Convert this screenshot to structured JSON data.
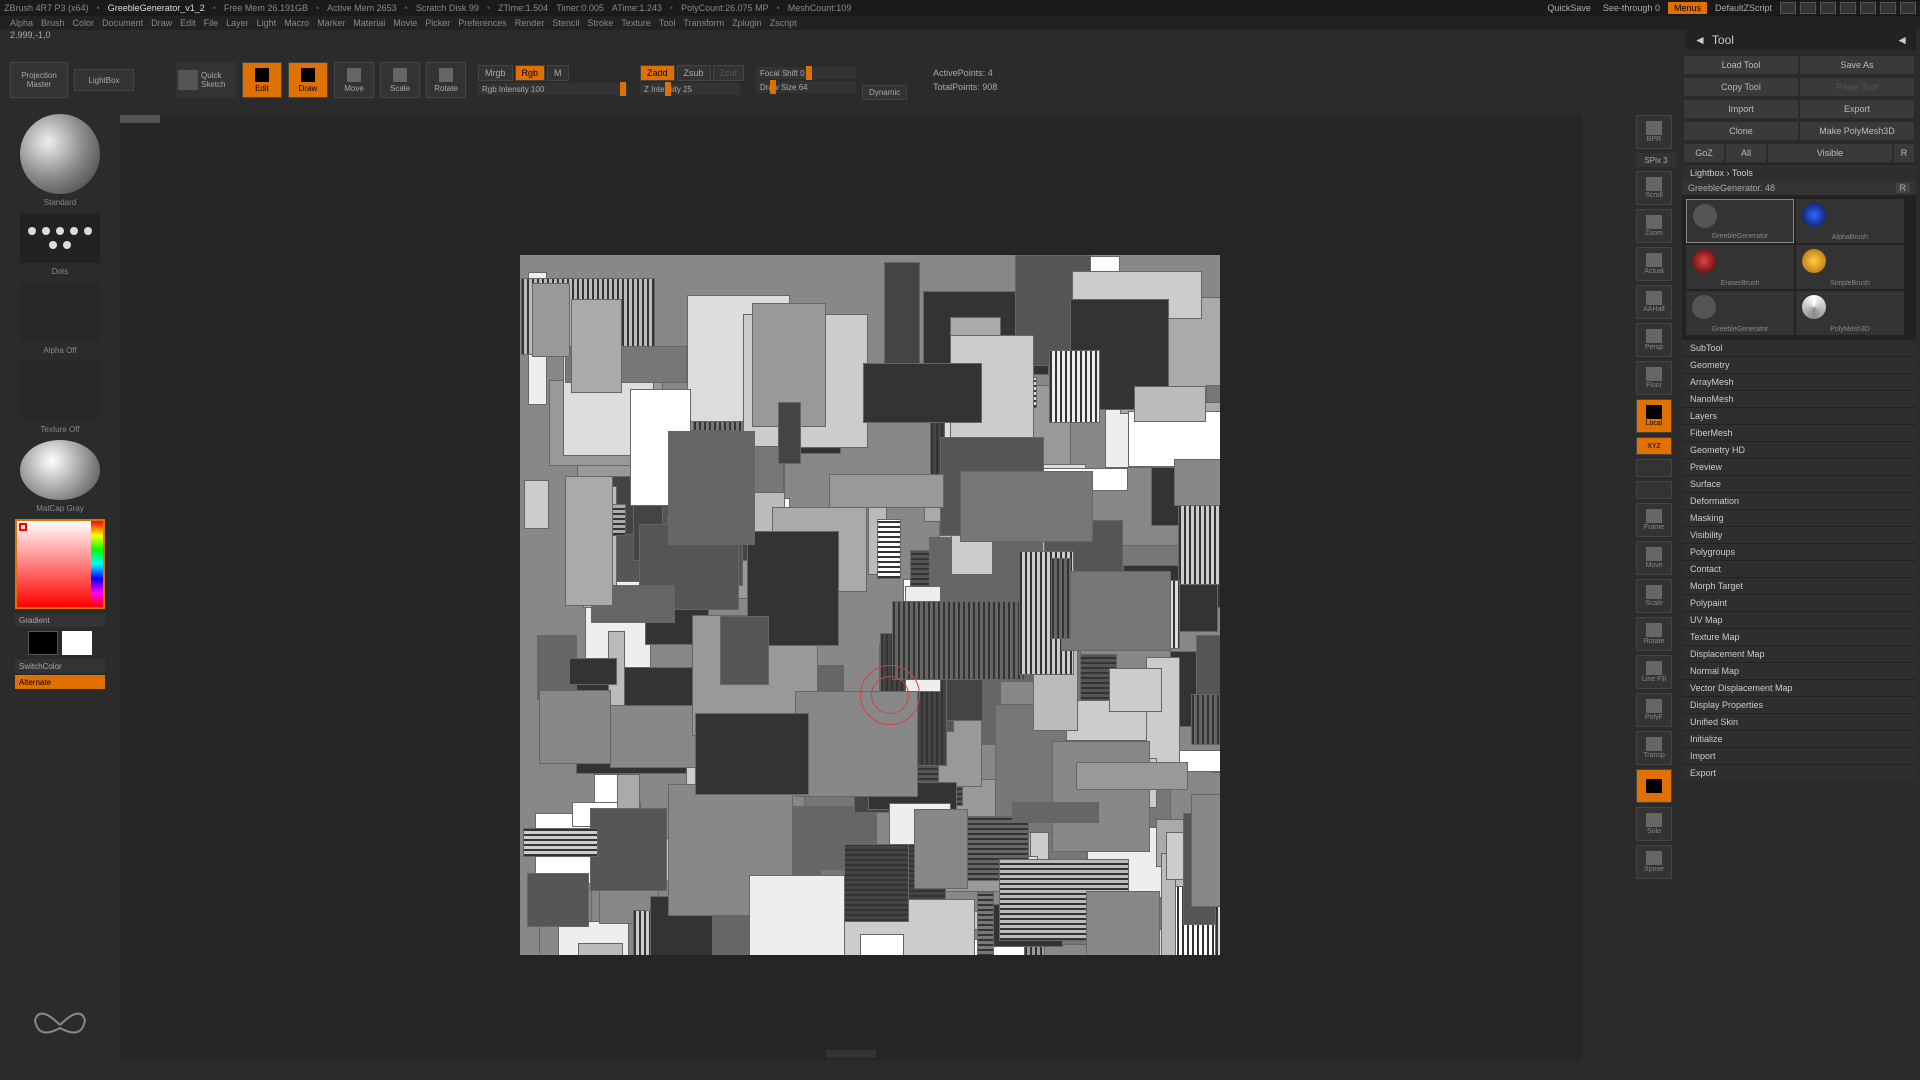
{
  "title": {
    "app": "ZBrush 4R7 P3 (x64)",
    "file": "GreebleGenerator_v1_2",
    "freemem": "Free Mem 26.191GB",
    "activemem": "Active Mem 2653",
    "scratch": "Scratch Disk 99",
    "ztime": "ZTime:1.504",
    "timer": "Timer:0.005",
    "atime": "ATime:1.243",
    "polycount": "PolyCount:26.075 MP",
    "meshcount": "MeshCount:109"
  },
  "titleright": {
    "quicksave": "QuickSave",
    "seethrough": "See-through  0",
    "menus": "Menus",
    "script": "DefaultZScript"
  },
  "menu": [
    "Alpha",
    "Brush",
    "Color",
    "Document",
    "Draw",
    "Edit",
    "File",
    "Layer",
    "Light",
    "Macro",
    "Marker",
    "Material",
    "Movie",
    "Picker",
    "Preferences",
    "Render",
    "Stencil",
    "Stroke",
    "Texture",
    "Tool",
    "Transform",
    "Zplugin",
    "Zscript"
  ],
  "status": "2.999,-1,0",
  "toolheader": "Tool",
  "toolbar": {
    "projection": "Projection\nMaster",
    "lightbox": "LightBox",
    "quicksketch": "Quick\nSketch",
    "edit": "Edit",
    "draw": "Draw",
    "move": "Move",
    "scale": "Scale",
    "rotate": "Rotate",
    "mrgb": "Mrgb",
    "rgb": "Rgb",
    "m": "M",
    "rgbIntensity": "Rgb Intensity 100",
    "zadd": "Zadd",
    "zsub": "Zsub",
    "zcut": "Zcut",
    "zIntensity": "Z Intensity 25",
    "focalShift": "Focal Shift 0",
    "drawSize": "Draw Size 64",
    "dynamic": "Dynamic",
    "activePoints": "ActivePoints: 4",
    "totalPoints": "TotalPoints: 908"
  },
  "left": {
    "brush": "Standard",
    "dots": "Dots",
    "alpha": "Alpha Off",
    "texture": "Texture Off",
    "material": "MatCap Gray",
    "gradient": "Gradient",
    "switchcolor": "SwitchColor",
    "alternate": "Alternate"
  },
  "rshelf": {
    "spix": "SPix 3",
    "items": [
      "BPR",
      "Scroll",
      "Zoom",
      "Actual",
      "AAHalf",
      "Persp",
      "Floor",
      "Local",
      "XYZ",
      "",
      "",
      "Frame",
      "Move",
      "Scale",
      "Rotate",
      "Line Fill",
      "PolyF",
      "Transp",
      "",
      "Solo",
      "Xpose"
    ]
  },
  "right": {
    "row1": {
      "a": "Load Tool",
      "b": "Save As"
    },
    "row2": {
      "a": "Copy Tool",
      "b": "Paste Tool"
    },
    "row3": {
      "a": "Import",
      "b": "Export"
    },
    "row4": {
      "a": "Clone",
      "b": "Make PolyMesh3D"
    },
    "row5": {
      "a": "GoZ",
      "b": "All",
      "c": "Visible",
      "d": "R"
    },
    "lightbox": "Lightbox › Tools",
    "toolname": "GreebleGenerator. 48",
    "r": "R",
    "tools": [
      "GreebleGenerator",
      "AlphaBrush",
      "EraserBrush",
      "SimpleBrush",
      "GreebleGenerator",
      "PolyMesh3D"
    ],
    "sections": [
      "SubTool",
      "Geometry",
      "ArrayMesh",
      "NanoMesh",
      "Layers",
      "FiberMesh",
      "Geometry HD",
      "Preview",
      "Surface",
      "Deformation",
      "Masking",
      "Visibility",
      "Polygroups",
      "Contact",
      "Morph Target",
      "Polypaint",
      "UV Map",
      "Texture Map",
      "Displacement Map",
      "Normal Map",
      "Vector Displacement Map",
      "Display Properties",
      "Unified Skin",
      "Initialize",
      "Import",
      "Export"
    ]
  }
}
